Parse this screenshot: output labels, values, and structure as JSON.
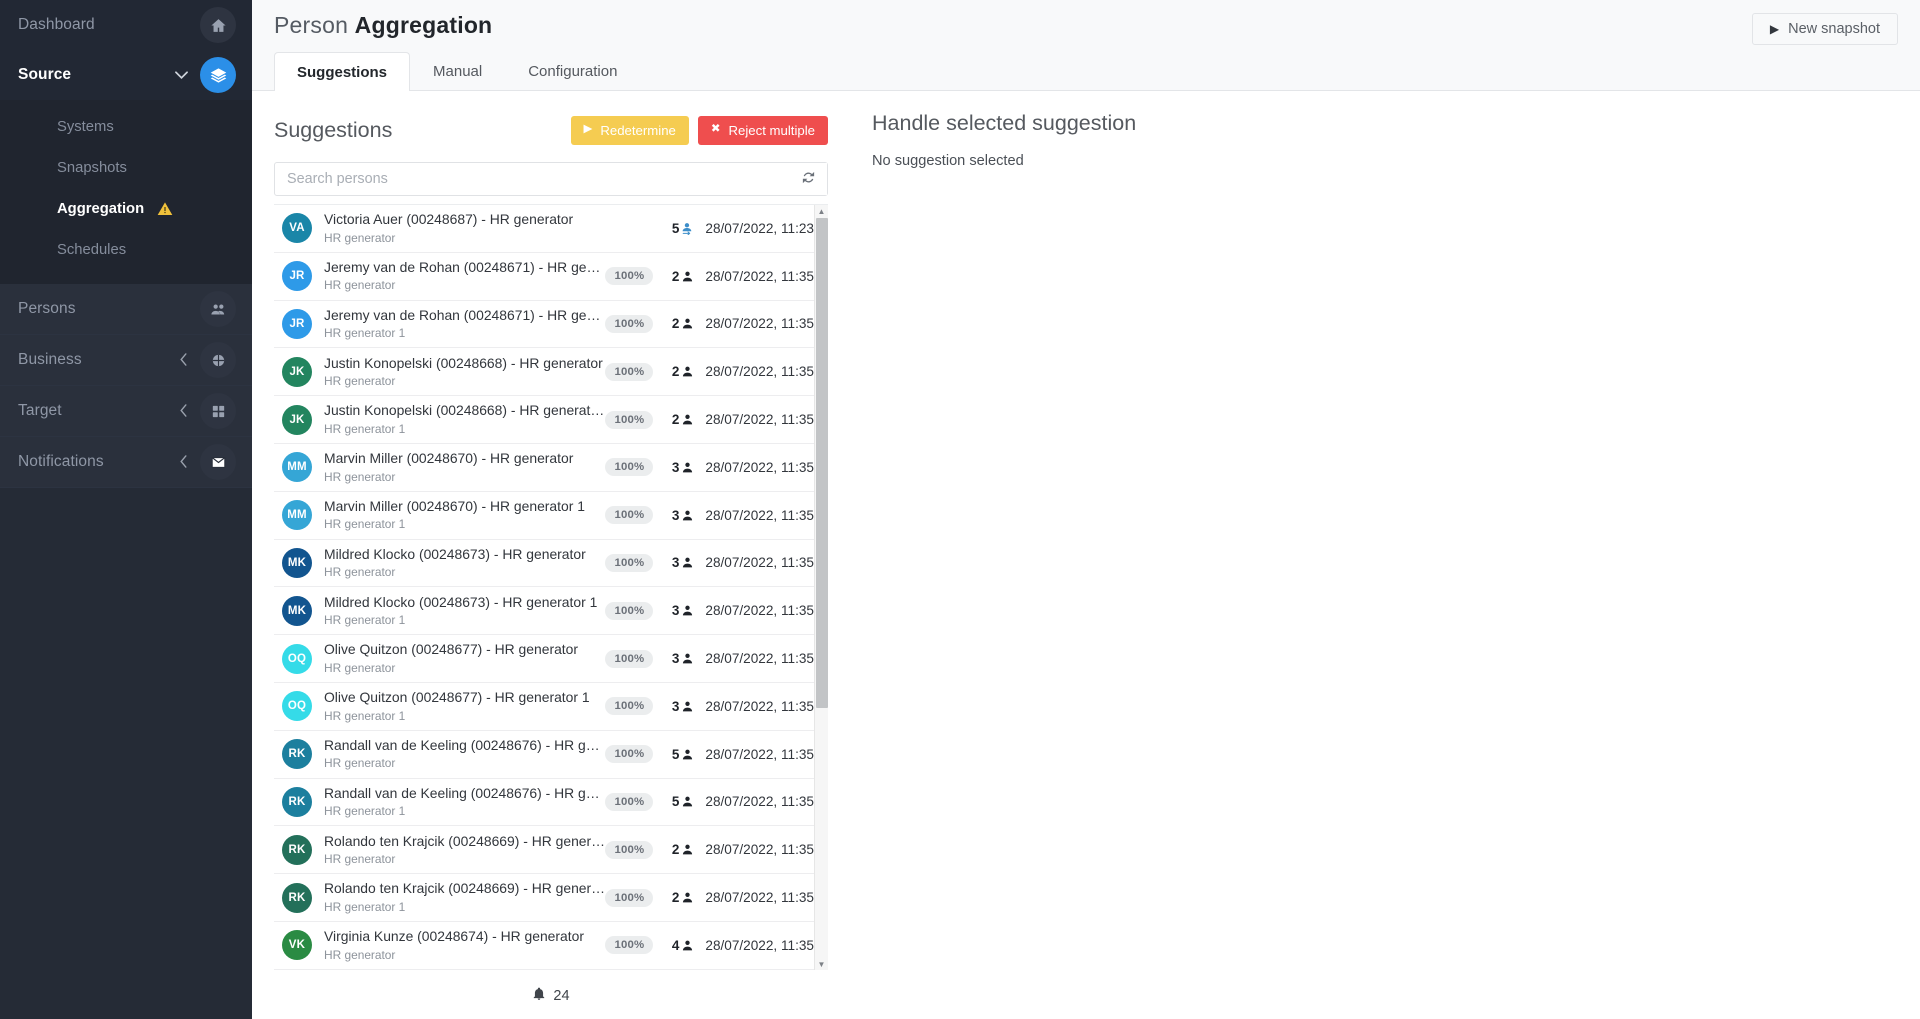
{
  "sidebar": {
    "top_items": [
      {
        "label": "Dashboard",
        "icon": "home-icon",
        "active": false,
        "accent": false,
        "chevron": ""
      },
      {
        "label": "Source",
        "icon": "layers-icon",
        "active": true,
        "accent": true,
        "chevron": "v"
      }
    ],
    "sub_items": [
      {
        "label": "Systems",
        "active": false,
        "warning": false
      },
      {
        "label": "Snapshots",
        "active": false,
        "warning": false
      },
      {
        "label": "Aggregation",
        "active": true,
        "warning": true
      },
      {
        "label": "Schedules",
        "active": false,
        "warning": false
      }
    ],
    "bottom_items": [
      {
        "label": "Persons",
        "icon": "people-icon",
        "chevron": ""
      },
      {
        "label": "Business",
        "icon": "org-icon",
        "chevron": "<"
      },
      {
        "label": "Target",
        "icon": "grid-icon",
        "chevron": "<"
      },
      {
        "label": "Notifications",
        "icon": "mail-icon",
        "chevron": "<"
      }
    ]
  },
  "header": {
    "title_light": "Person",
    "title_bold": "Aggregation",
    "new_snapshot_label": "New snapshot",
    "new_snapshot_icon": "play-icon"
  },
  "tabs": [
    {
      "label": "Suggestions",
      "active": true
    },
    {
      "label": "Manual",
      "active": false
    },
    {
      "label": "Configuration",
      "active": false
    }
  ],
  "suggestions_panel": {
    "title": "Suggestions",
    "redetermine_label": "Redetermine",
    "redetermine_icon": "play-icon",
    "redetermine_color": "#f5cc51",
    "reject_label": "Reject multiple",
    "reject_icon": "close-icon",
    "reject_color": "#ef4e4e",
    "search_placeholder": "Search persons",
    "search_value": "",
    "refresh_icon": "refresh-icon",
    "footer_count": "24",
    "footer_icon": "bell-icon"
  },
  "detail_panel": {
    "title": "Handle selected suggestion",
    "empty_text": "No suggestion selected"
  },
  "rows": [
    {
      "initials": "VA",
      "color": "#1a86a8",
      "title": "Victoria Auer (00248687) - HR generator",
      "sub": "HR generator",
      "pct": "",
      "count": "5",
      "count_icon": "person-export-icon",
      "count_blue": true,
      "date": "28/07/2022, 11:23"
    },
    {
      "initials": "JR",
      "color": "#2e9ae8",
      "title": "Jeremy van de Rohan (00248671) - HR gene…",
      "sub": "HR generator",
      "pct": "100%",
      "count": "2",
      "count_icon": "person-icon",
      "count_blue": false,
      "date": "28/07/2022, 11:35"
    },
    {
      "initials": "JR",
      "color": "#2e9ae8",
      "title": "Jeremy van de Rohan (00248671) - HR gene…",
      "sub": "HR generator 1",
      "pct": "100%",
      "count": "2",
      "count_icon": "person-icon",
      "count_blue": false,
      "date": "28/07/2022, 11:35"
    },
    {
      "initials": "JK",
      "color": "#23855f",
      "title": "Justin Konopelski (00248668) - HR generator",
      "sub": "HR generator",
      "pct": "100%",
      "count": "2",
      "count_icon": "person-icon",
      "count_blue": false,
      "date": "28/07/2022, 11:35"
    },
    {
      "initials": "JK",
      "color": "#23855f",
      "title": "Justin Konopelski (00248668) - HR generato…",
      "sub": "HR generator 1",
      "pct": "100%",
      "count": "2",
      "count_icon": "person-icon",
      "count_blue": false,
      "date": "28/07/2022, 11:35"
    },
    {
      "initials": "MM",
      "color": "#35a6d6",
      "title": "Marvin Miller (00248670) - HR generator",
      "sub": "HR generator",
      "pct": "100%",
      "count": "3",
      "count_icon": "person-icon",
      "count_blue": false,
      "date": "28/07/2022, 11:35"
    },
    {
      "initials": "MM",
      "color": "#35a6d6",
      "title": "Marvin Miller (00248670) - HR generator 1",
      "sub": "HR generator 1",
      "pct": "100%",
      "count": "3",
      "count_icon": "person-icon",
      "count_blue": false,
      "date": "28/07/2022, 11:35"
    },
    {
      "initials": "MK",
      "color": "#12558f",
      "title": "Mildred Klocko (00248673) - HR generator",
      "sub": "HR generator",
      "pct": "100%",
      "count": "3",
      "count_icon": "person-icon",
      "count_blue": false,
      "date": "28/07/2022, 11:35"
    },
    {
      "initials": "MK",
      "color": "#12558f",
      "title": "Mildred Klocko (00248673) - HR generator 1",
      "sub": "HR generator 1",
      "pct": "100%",
      "count": "3",
      "count_icon": "person-icon",
      "count_blue": false,
      "date": "28/07/2022, 11:35"
    },
    {
      "initials": "OQ",
      "color": "#35dbe8",
      "title": "Olive Quitzon (00248677) - HR generator",
      "sub": "HR generator",
      "pct": "100%",
      "count": "3",
      "count_icon": "person-icon",
      "count_blue": false,
      "date": "28/07/2022, 11:35"
    },
    {
      "initials": "OQ",
      "color": "#35dbe8",
      "title": "Olive Quitzon (00248677) - HR generator 1",
      "sub": "HR generator 1",
      "pct": "100%",
      "count": "3",
      "count_icon": "person-icon",
      "count_blue": false,
      "date": "28/07/2022, 11:35"
    },
    {
      "initials": "RK",
      "color": "#1c7f9e",
      "title": "Randall van de Keeling (00248676) - HR gen…",
      "sub": "HR generator",
      "pct": "100%",
      "count": "5",
      "count_icon": "person-icon",
      "count_blue": false,
      "date": "28/07/2022, 11:35"
    },
    {
      "initials": "RK",
      "color": "#1c7f9e",
      "title": "Randall van de Keeling (00248676) - HR gen…",
      "sub": "HR generator 1",
      "pct": "100%",
      "count": "5",
      "count_icon": "person-icon",
      "count_blue": false,
      "date": "28/07/2022, 11:35"
    },
    {
      "initials": "RK",
      "color": "#23705a",
      "title": "Rolando ten Krajcik (00248669) - HR generat…",
      "sub": "HR generator",
      "pct": "100%",
      "count": "2",
      "count_icon": "person-icon",
      "count_blue": false,
      "date": "28/07/2022, 11:35"
    },
    {
      "initials": "RK",
      "color": "#23705a",
      "title": "Rolando ten Krajcik (00248669) - HR generat…",
      "sub": "HR generator 1",
      "pct": "100%",
      "count": "2",
      "count_icon": "person-icon",
      "count_blue": false,
      "date": "28/07/2022, 11:35"
    },
    {
      "initials": "VK",
      "color": "#2a8b43",
      "title": "Virginia Kunze (00248674) - HR generator",
      "sub": "HR generator",
      "pct": "100%",
      "count": "4",
      "count_icon": "person-icon",
      "count_blue": false,
      "date": "28/07/2022, 11:35"
    }
  ]
}
